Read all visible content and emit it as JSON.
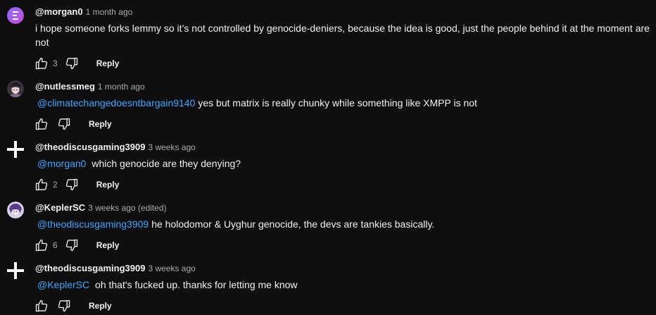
{
  "reply_label": "Reply",
  "colors": {
    "background": "#0f0f0f",
    "text": "#f1f1f1",
    "meta": "#aaaaaa",
    "mention": "#3ea6ff"
  },
  "comments": [
    {
      "author": "@morgan0",
      "time": "1 month ago",
      "text": "i hope someone forks lemmy so it’s not controlled by genocide-deniers, because the idea is good, just the people behind it at the moment are not",
      "likes": "3",
      "avatar": "purple-logo-avatar"
    },
    {
      "author": "@nutlessmeg",
      "time": "1 month ago",
      "mention": "@climatechangedoesntbargain9140",
      "text": "yes but matrix is really chunky while something like XMPP is not",
      "likes": "",
      "avatar": "anime-character-avatar"
    },
    {
      "author": "@theodiscusgaming3909",
      "time": "3 weeks ago",
      "mention": "@morgan0",
      "text": " which genocide are they denying?",
      "likes": "2",
      "avatar": "white-plus-avatar"
    },
    {
      "author": "@KeplerSC",
      "time": "3 weeks ago (edited)",
      "mention": "@theodiscusgaming3909",
      "text": "he holodomor & Uyghur genocide, the devs are tankies basically.",
      "likes": "6",
      "avatar": "purple-anime-avatar"
    },
    {
      "author": "@theodiscusgaming3909",
      "time": "3 weeks ago",
      "mention": "@KeplerSC",
      "text": " oh that's fucked up. thanks for letting me know",
      "likes": "",
      "avatar": "white-plus-avatar"
    }
  ]
}
